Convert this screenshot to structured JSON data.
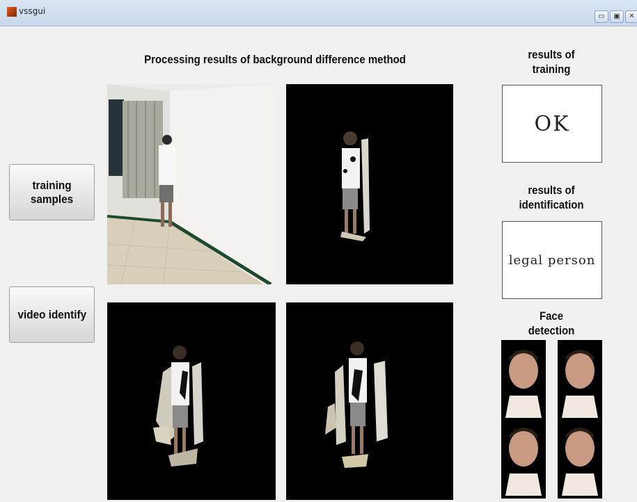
{
  "window": {
    "title": "vssgui",
    "controls": [
      "▭",
      "▣",
      "✕"
    ]
  },
  "main": {
    "heading": "Processing results of background difference method"
  },
  "buttons": {
    "training": "training samples",
    "identify": "video identify"
  },
  "results": {
    "training_label_1": "results of",
    "training_label_2": "training",
    "training_value": "OK",
    "identification_label_1": "results of",
    "identification_label_2": "identification",
    "identification_value": "legal person",
    "face_label_1": "Face",
    "face_label_2": "detection"
  },
  "colors": {
    "titlebar": "#c9d8ec",
    "background": "#f0f0f0",
    "panel": "#000000"
  }
}
